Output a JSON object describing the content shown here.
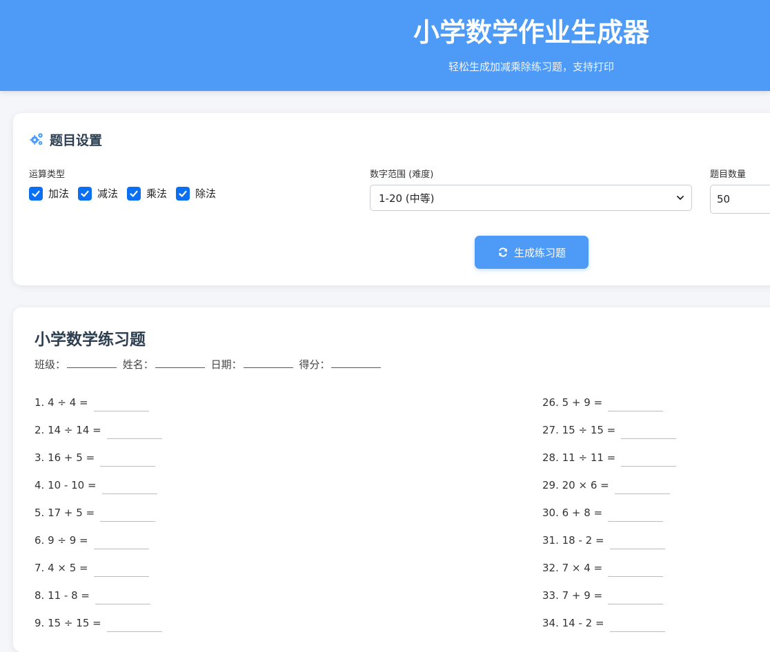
{
  "header": {
    "title": "小学数学作业生成器",
    "subtitle": "轻松生成加减乘除练习题，支持打印"
  },
  "settings": {
    "title": "题目设置",
    "operation_label": "运算类型",
    "operations": [
      {
        "label": "加法",
        "checked": true
      },
      {
        "label": "减法",
        "checked": true
      },
      {
        "label": "乘法",
        "checked": true
      },
      {
        "label": "除法",
        "checked": true
      }
    ],
    "range_label": "数字范围 (难度)",
    "range_value": "1-20 (中等)",
    "count_label": "题目数量",
    "count_value": "50",
    "generate_label": "生成练习题"
  },
  "sheet": {
    "title": "小学数学练习题",
    "info": [
      "班级：",
      "姓名：",
      "日期：",
      "得分："
    ],
    "left": [
      "1. 4 ÷ 4 =",
      "2. 14 ÷ 14 =",
      "3. 16 + 5 =",
      "4. 10 - 10 =",
      "5. 17 + 5 =",
      "6. 9 ÷ 9 =",
      "7. 4 × 5 =",
      "8. 11 - 8 =",
      "9. 15 ÷ 15 ="
    ],
    "right": [
      "26. 5 + 9 =",
      "27. 15 ÷ 15 =",
      "28. 11 ÷ 11 =",
      "29. 20 × 6 =",
      "30. 6 + 8 =",
      "31. 18 - 2 =",
      "32. 7 × 4 =",
      "33. 7 + 9 =",
      "34. 14 - 2 ="
    ]
  },
  "icons": {
    "settings": "gears-icon",
    "generate": "refresh-icon",
    "checkbox": "check-icon",
    "select": "chevron-down-icon"
  },
  "colors": {
    "accent": "#4d9af7",
    "checkbox": "#0b6ff2"
  }
}
